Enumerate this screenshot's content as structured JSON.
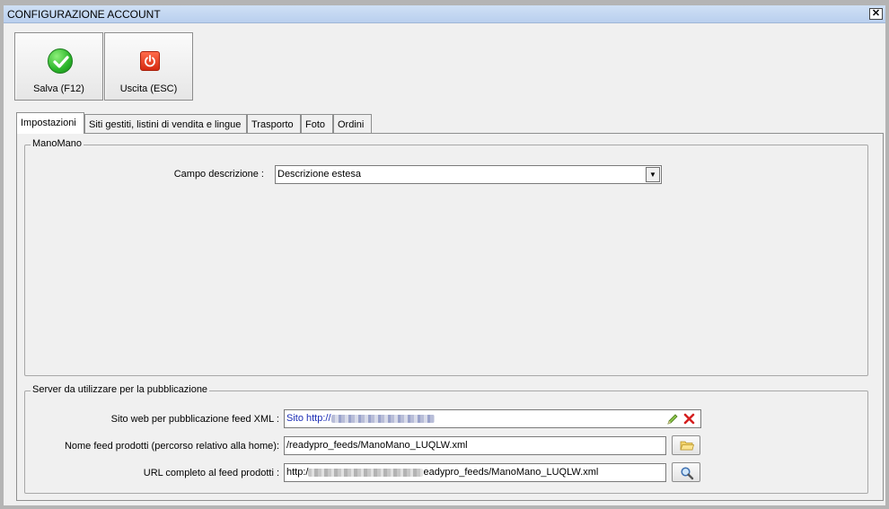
{
  "window": {
    "title": "CONFIGURAZIONE ACCOUNT",
    "close_glyph": "✕"
  },
  "toolbar": {
    "save": {
      "label": "Salva (F12)",
      "icon": "check-icon",
      "color": "#2bb52a"
    },
    "exit": {
      "label": "Uscita (ESC)",
      "icon": "power-icon",
      "color": "#d62a10"
    }
  },
  "tabs": [
    {
      "label": "Impostazioni",
      "active": true
    },
    {
      "label": "Siti gestiti, listini di vendita e lingue",
      "active": false
    },
    {
      "label": "Trasporto",
      "active": false
    },
    {
      "label": "Foto",
      "active": false
    },
    {
      "label": "Ordini",
      "active": false
    }
  ],
  "manomano": {
    "legend": "ManoMano",
    "campo_label": "Campo descrizione :",
    "campo_value": "Descrizione estesa"
  },
  "server": {
    "legend": "Server da utilizzare per la pubblicazione",
    "sito_label": "Sito web per pubblicazione feed XML :",
    "sito_value_prefix": "Sito http://",
    "nome_label": "Nome feed prodotti (percorso relativo alla home):",
    "nome_value": "/readypro_feeds/ManoMano_LUQLW.xml",
    "url_label": "URL completo al feed prodotti :",
    "url_prefix": "http:/",
    "url_suffix": "eadypro_feeds/ManoMano_LUQLW.xml"
  }
}
